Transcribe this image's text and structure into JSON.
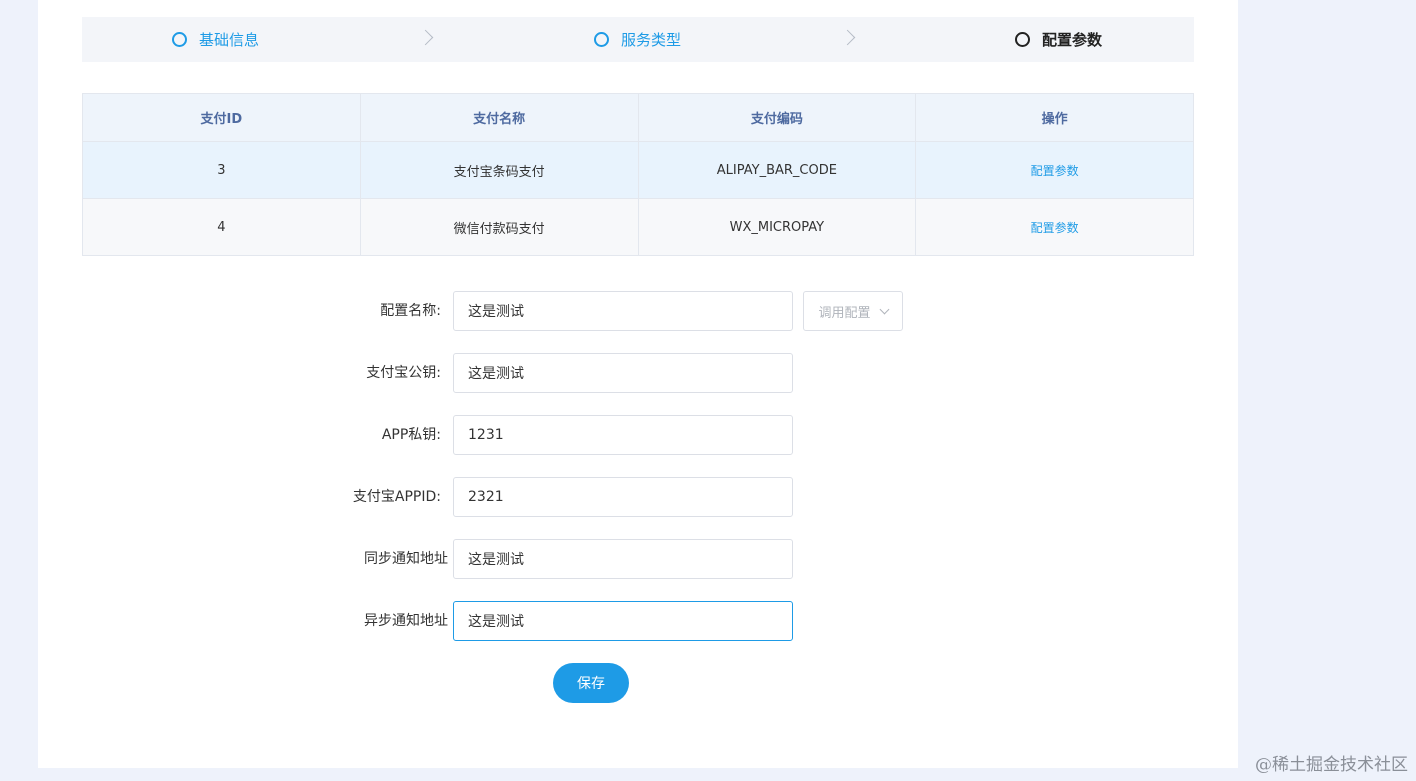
{
  "steps": [
    {
      "label": "基础信息",
      "state": "done"
    },
    {
      "label": "服务类型",
      "state": "done"
    },
    {
      "label": "配置参数",
      "state": "active"
    }
  ],
  "table": {
    "headers": [
      "支付ID",
      "支付名称",
      "支付编码",
      "操作"
    ],
    "rows": [
      {
        "id": "3",
        "name": "支付宝条码支付",
        "code": "ALIPAY_BAR_CODE",
        "action": "配置参数"
      },
      {
        "id": "4",
        "name": "微信付款码支付",
        "code": "WX_MICROPAY",
        "action": "配置参数"
      }
    ]
  },
  "form": {
    "fields": [
      {
        "label": "配置名称:",
        "value": "这是测试"
      },
      {
        "label": "支付宝公钥:",
        "value": "这是测试"
      },
      {
        "label": "APP私钥:",
        "value": "1231"
      },
      {
        "label": "支付宝APPID:",
        "value": "2321"
      },
      {
        "label": "同步通知地址",
        "value": "这是测试"
      },
      {
        "label": "异步通知地址",
        "value": "这是测试"
      }
    ],
    "select_label": "调用配置",
    "save_label": "保存"
  },
  "watermark": "@稀土掘金技术社区",
  "colors": {
    "accent": "#1e9be6",
    "background": "#eef2fb"
  }
}
